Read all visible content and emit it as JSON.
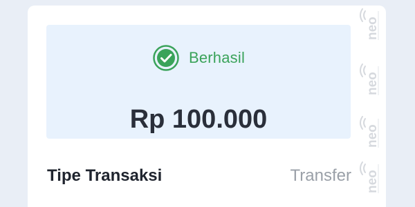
{
  "transaction": {
    "status": "Berhasil",
    "amount": "Rp 100.000",
    "status_color": "#3aa35a",
    "status_icon": "check-circle-icon"
  },
  "details": [
    {
      "label": "Tipe Transaksi",
      "value": "Transfer"
    }
  ],
  "watermark": {
    "logo_text": "neo",
    "icon": "signal-waves-icon"
  }
}
